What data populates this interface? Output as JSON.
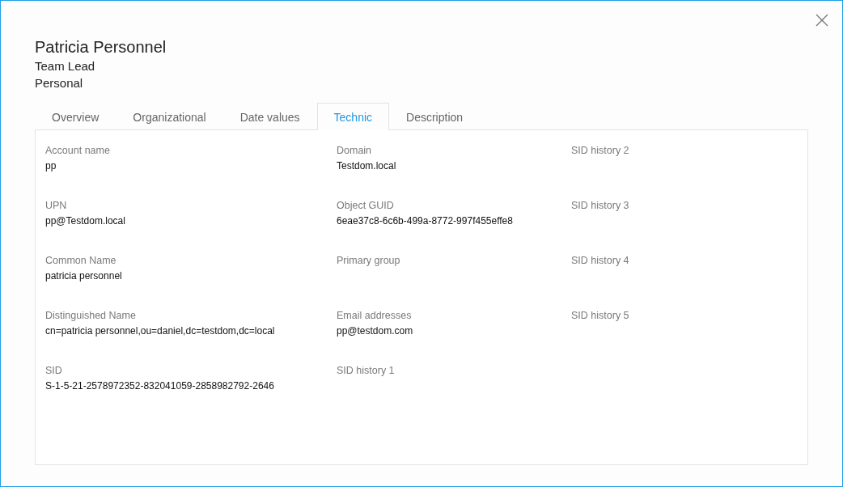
{
  "header": {
    "name": "Patricia Personnel",
    "title": "Team Lead",
    "department": "Personal"
  },
  "tabs": [
    {
      "label": "Overview",
      "selected": false
    },
    {
      "label": "Organizational",
      "selected": false
    },
    {
      "label": "Date values",
      "selected": false
    },
    {
      "label": "Technic",
      "selected": true
    },
    {
      "label": "Description",
      "selected": false
    }
  ],
  "columns": [
    {
      "fields": [
        {
          "label": "Account name",
          "value": "pp"
        },
        {
          "label": "UPN",
          "value": "pp@Testdom.local"
        },
        {
          "label": "Common Name",
          "value": "patricia personnel"
        },
        {
          "label": "Distinguished Name",
          "value": "cn=patricia personnel,ou=daniel,dc=testdom,dc=local"
        },
        {
          "label": "SID",
          "value": "S-1-5-21-2578972352-832041059-2858982792-2646"
        }
      ]
    },
    {
      "fields": [
        {
          "label": "Domain",
          "value": "Testdom.local"
        },
        {
          "label": "Object GUID",
          "value": "6eae37c8-6c6b-499a-8772-997f455effe8"
        },
        {
          "label": "Primary group"
        },
        {
          "label": "Email addresses",
          "value": "pp@testdom.com"
        },
        {
          "label": "SID history 1"
        }
      ]
    },
    {
      "fields": [
        {
          "label": "SID history 2"
        },
        {
          "label": "SID history 3"
        },
        {
          "label": "SID history 4"
        },
        {
          "label": "SID history 5"
        }
      ]
    }
  ]
}
